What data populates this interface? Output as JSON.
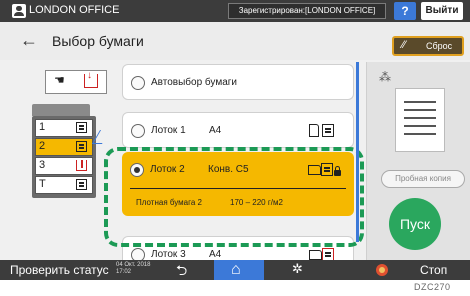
{
  "topbar": {
    "user_name": "LONDON OFFICE",
    "status": "Зарегистрирован:[LONDON OFFICE]",
    "help_label": "?",
    "logout_label": "Выйти"
  },
  "header": {
    "title": "Выбор бумаги",
    "reset_label": "Сброс"
  },
  "tray_diagram": {
    "trays": [
      {
        "num": "1",
        "selected": false
      },
      {
        "num": "2",
        "selected": true
      },
      {
        "num": "3",
        "selected": false
      },
      {
        "num": "T",
        "selected": false
      }
    ]
  },
  "paper_list": {
    "items": [
      {
        "name": "Автовыбор бумаги",
        "size": "",
        "selected": false
      },
      {
        "name": "Лоток 1",
        "size": "A4",
        "selected": false
      },
      {
        "name": "Лоток 2",
        "size": "Конв. C5",
        "selected": true,
        "type": "Плотная бумага 2",
        "weight": "170 – 220 г/м2"
      },
      {
        "name": "Лоток 3",
        "size": "A4",
        "selected": false
      }
    ]
  },
  "right_panel": {
    "sample_label": "Пробная копия",
    "start_label": "Пуск"
  },
  "bottombar": {
    "check_status": "Проверить статус",
    "date": "04 Окт. 2018",
    "time": "17:02",
    "stop_label": "Стоп"
  },
  "figure_code": "DZC270",
  "colors": {
    "selection": "#f5b800",
    "start": "#2aa75e",
    "accent": "#3c79d8",
    "highlight_outline": "#1c9a55"
  }
}
